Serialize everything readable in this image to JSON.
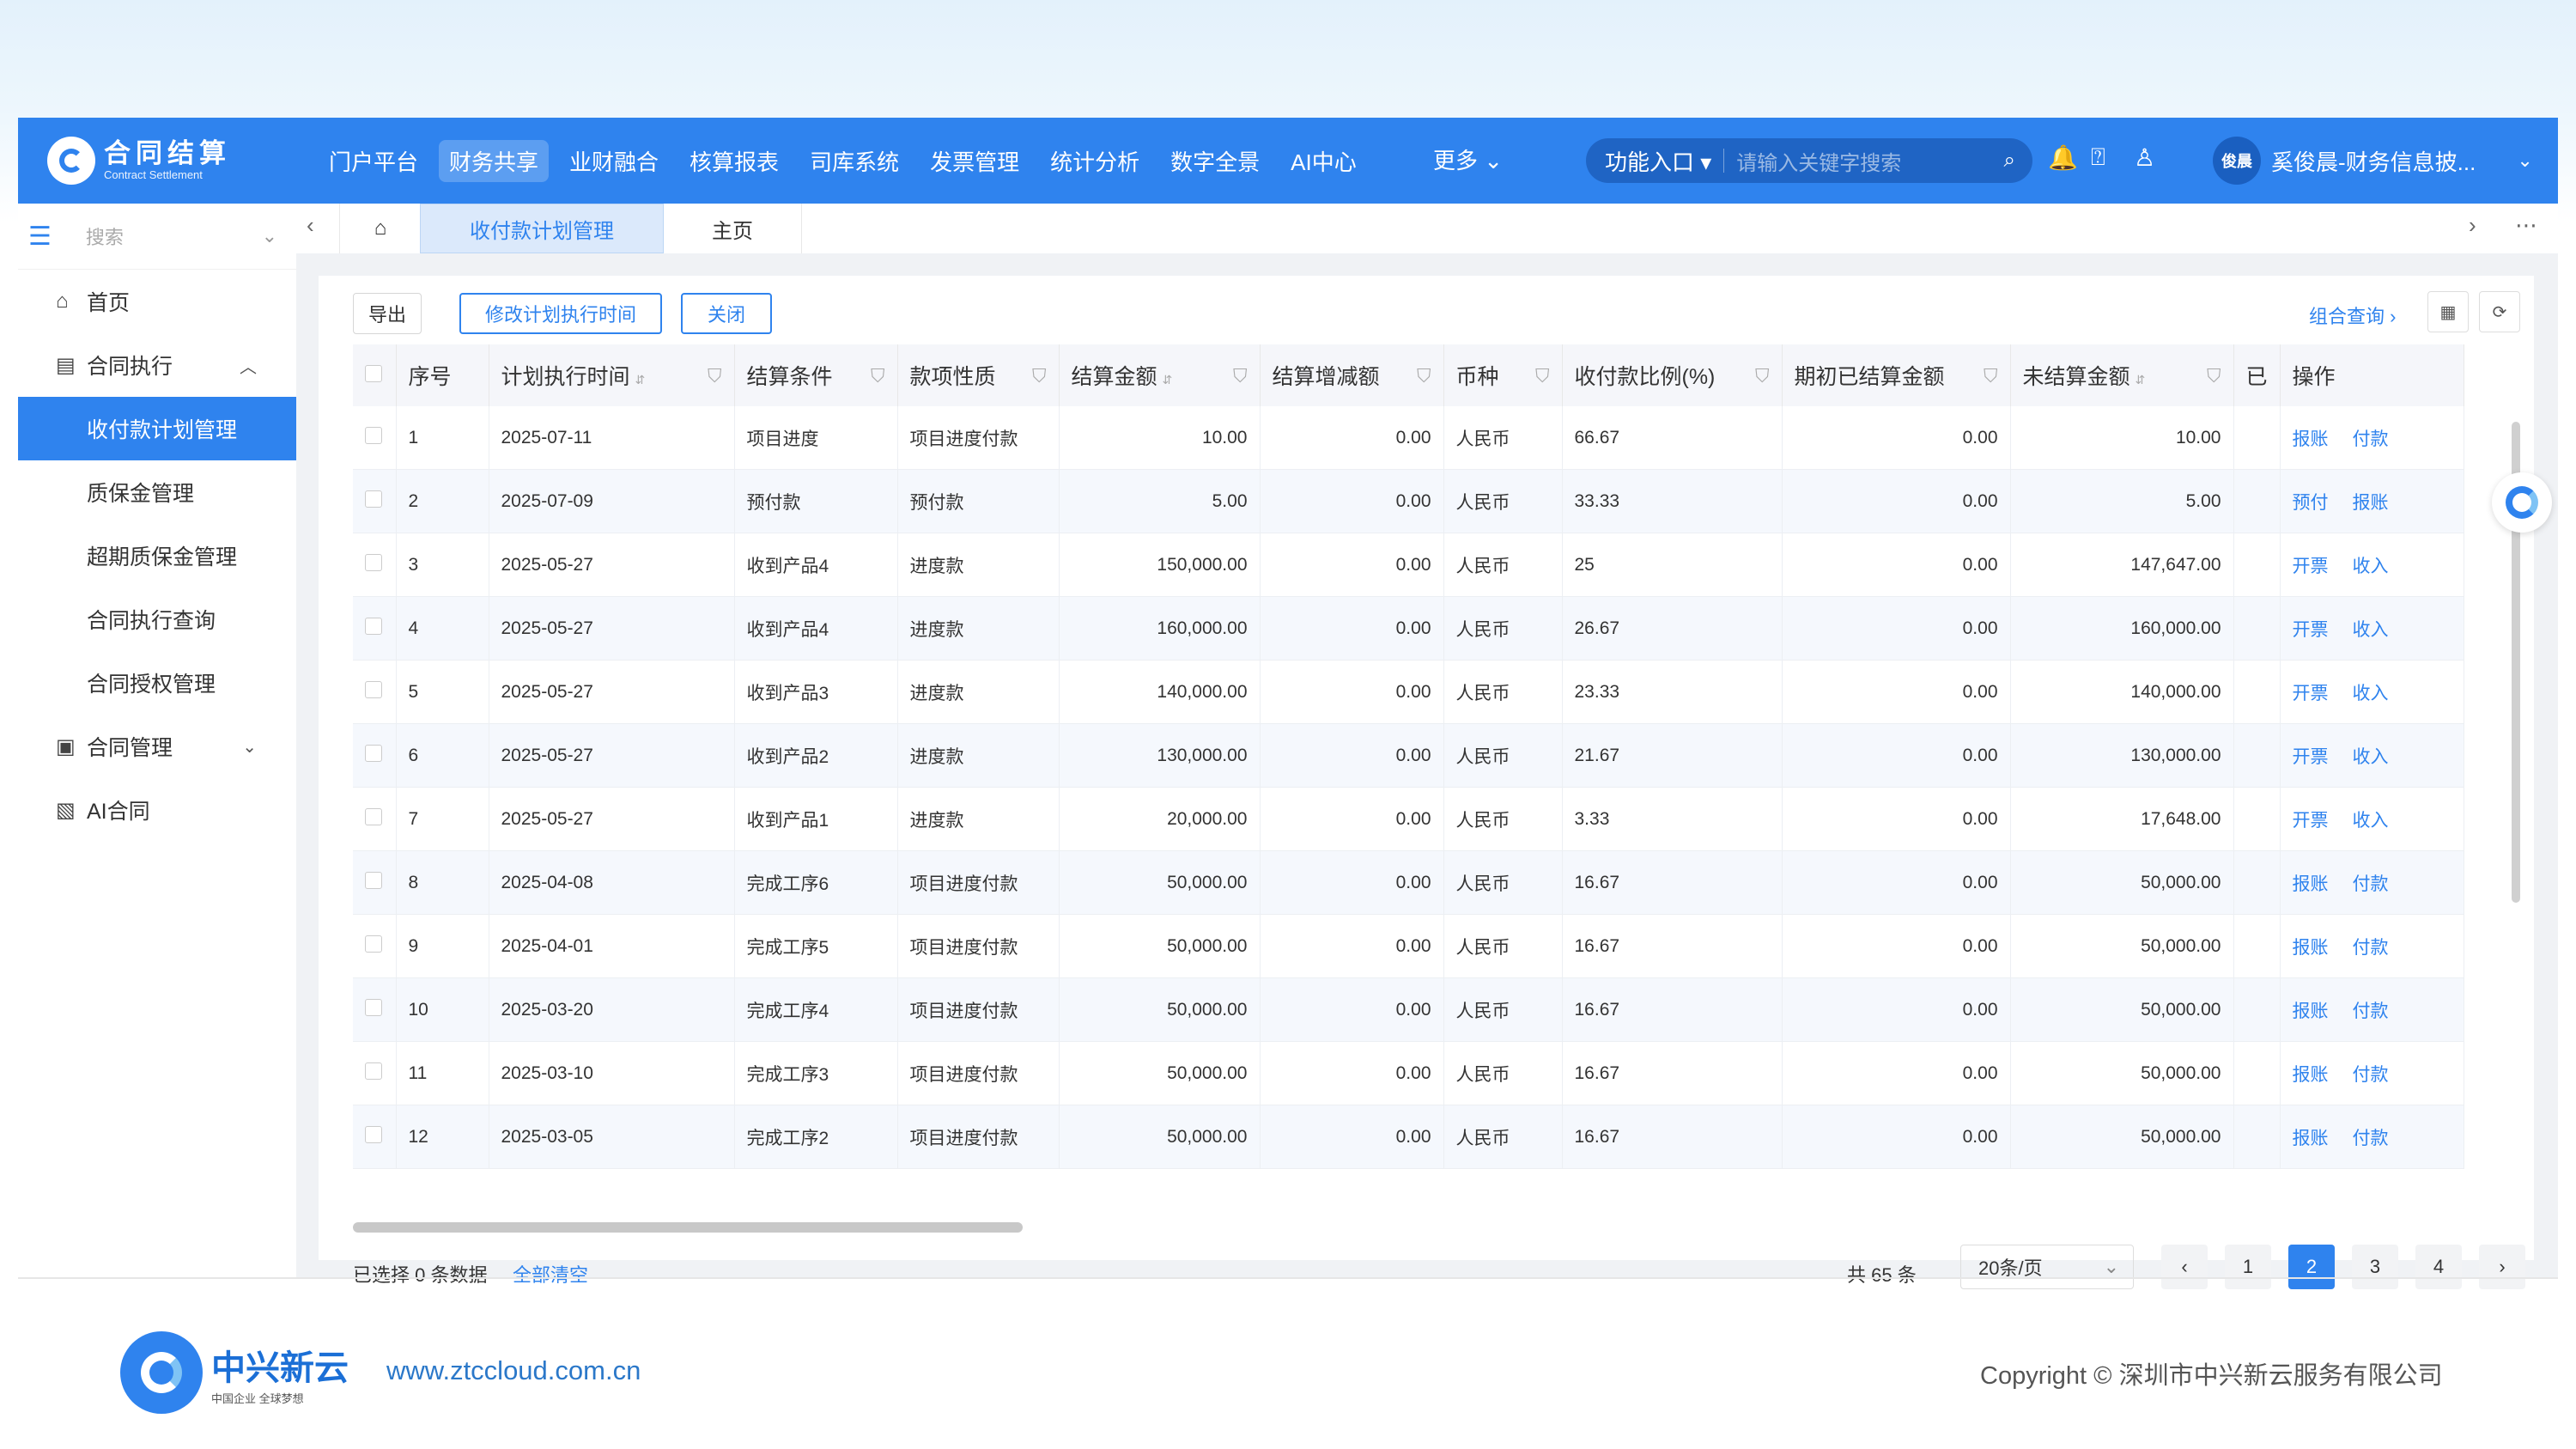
{
  "app": {
    "logo_title": "合同结算",
    "logo_sub": "Contract Settlement",
    "nav": [
      "门户平台",
      "财务共享",
      "业财融合",
      "核算报表",
      "司库系统",
      "发票管理",
      "统计分析",
      "数字全景",
      "AI中心"
    ],
    "more": "更多",
    "function_entry": "功能入口",
    "search_placeholder": "请输入关键字搜索",
    "user_avatar": "俊晨",
    "user_name": "奚俊晨-财务信息披..."
  },
  "sidebar": {
    "search_placeholder": "搜索",
    "items": [
      {
        "label": "首页",
        "icon": "home-icon"
      },
      {
        "label": "合同执行",
        "icon": "document-icon"
      },
      {
        "label": "收付款计划管理"
      },
      {
        "label": "质保金管理"
      },
      {
        "label": "超期质保金管理"
      },
      {
        "label": "合同执行查询"
      },
      {
        "label": "合同授权管理"
      },
      {
        "label": "合同管理",
        "icon": "building-icon"
      },
      {
        "label": "AI合同",
        "icon": "ai-doc-icon"
      }
    ]
  },
  "tabs": [
    "收付款计划管理",
    "主页"
  ],
  "toolbar": {
    "export": "导出",
    "modify_time": "修改计划执行时间",
    "close": "关闭",
    "combo_query": "组合查询"
  },
  "table": {
    "headers": [
      "序号",
      "计划执行时间",
      "结算条件",
      "款项性质",
      "结算金额",
      "结算增减额",
      "币种",
      "收付款比例(%)",
      "期初已结算金额",
      "未结算金额",
      "已",
      "操作"
    ],
    "rows": [
      [
        "1",
        "2025-07-11",
        "项目进度",
        "项目进度付款",
        "10.00",
        "0.00",
        "人民币",
        "66.67",
        "0.00",
        "10.00",
        "报账",
        "付款"
      ],
      [
        "2",
        "2025-07-09",
        "预付款",
        "预付款",
        "5.00",
        "0.00",
        "人民币",
        "33.33",
        "0.00",
        "5.00",
        "预付",
        "报账"
      ],
      [
        "3",
        "2025-05-27",
        "收到产品4",
        "进度款",
        "150,000.00",
        "0.00",
        "人民币",
        "25",
        "0.00",
        "147,647.00",
        "开票",
        "收入"
      ],
      [
        "4",
        "2025-05-27",
        "收到产品4",
        "进度款",
        "160,000.00",
        "0.00",
        "人民币",
        "26.67",
        "0.00",
        "160,000.00",
        "开票",
        "收入"
      ],
      [
        "5",
        "2025-05-27",
        "收到产品3",
        "进度款",
        "140,000.00",
        "0.00",
        "人民币",
        "23.33",
        "0.00",
        "140,000.00",
        "开票",
        "收入"
      ],
      [
        "6",
        "2025-05-27",
        "收到产品2",
        "进度款",
        "130,000.00",
        "0.00",
        "人民币",
        "21.67",
        "0.00",
        "130,000.00",
        "开票",
        "收入"
      ],
      [
        "7",
        "2025-05-27",
        "收到产品1",
        "进度款",
        "20,000.00",
        "0.00",
        "人民币",
        "3.33",
        "0.00",
        "17,648.00",
        "开票",
        "收入"
      ],
      [
        "8",
        "2025-04-08",
        "完成工序6",
        "项目进度付款",
        "50,000.00",
        "0.00",
        "人民币",
        "16.67",
        "0.00",
        "50,000.00",
        "报账",
        "付款"
      ],
      [
        "9",
        "2025-04-01",
        "完成工序5",
        "项目进度付款",
        "50,000.00",
        "0.00",
        "人民币",
        "16.67",
        "0.00",
        "50,000.00",
        "报账",
        "付款"
      ],
      [
        "10",
        "2025-03-20",
        "完成工序4",
        "项目进度付款",
        "50,000.00",
        "0.00",
        "人民币",
        "16.67",
        "0.00",
        "50,000.00",
        "报账",
        "付款"
      ],
      [
        "11",
        "2025-03-10",
        "完成工序3",
        "项目进度付款",
        "50,000.00",
        "0.00",
        "人民币",
        "16.67",
        "0.00",
        "50,000.00",
        "报账",
        "付款"
      ],
      [
        "12",
        "2025-03-05",
        "完成工序2",
        "项目进度付款",
        "50,000.00",
        "0.00",
        "人民币",
        "16.67",
        "0.00",
        "50,000.00",
        "报账",
        "付款"
      ]
    ]
  },
  "footer": {
    "selected": "已选择 0 条数据",
    "clear_all": "全部清空",
    "total": "共 65 条",
    "page_size": "20条/页",
    "pages": [
      "1",
      "2",
      "3",
      "4"
    ],
    "current_page": "2"
  },
  "page_footer": {
    "brand": "中兴新云",
    "brand_sub": "中国企业 全球梦想",
    "url": "www.ztccloud.com.cn",
    "copyright": "Copyright © 深圳市中兴新云服务有限公司"
  },
  "colors": {
    "primary": "#2f83ee",
    "header_bg": "#2f83ee",
    "active_menu": "#2f83ee"
  }
}
